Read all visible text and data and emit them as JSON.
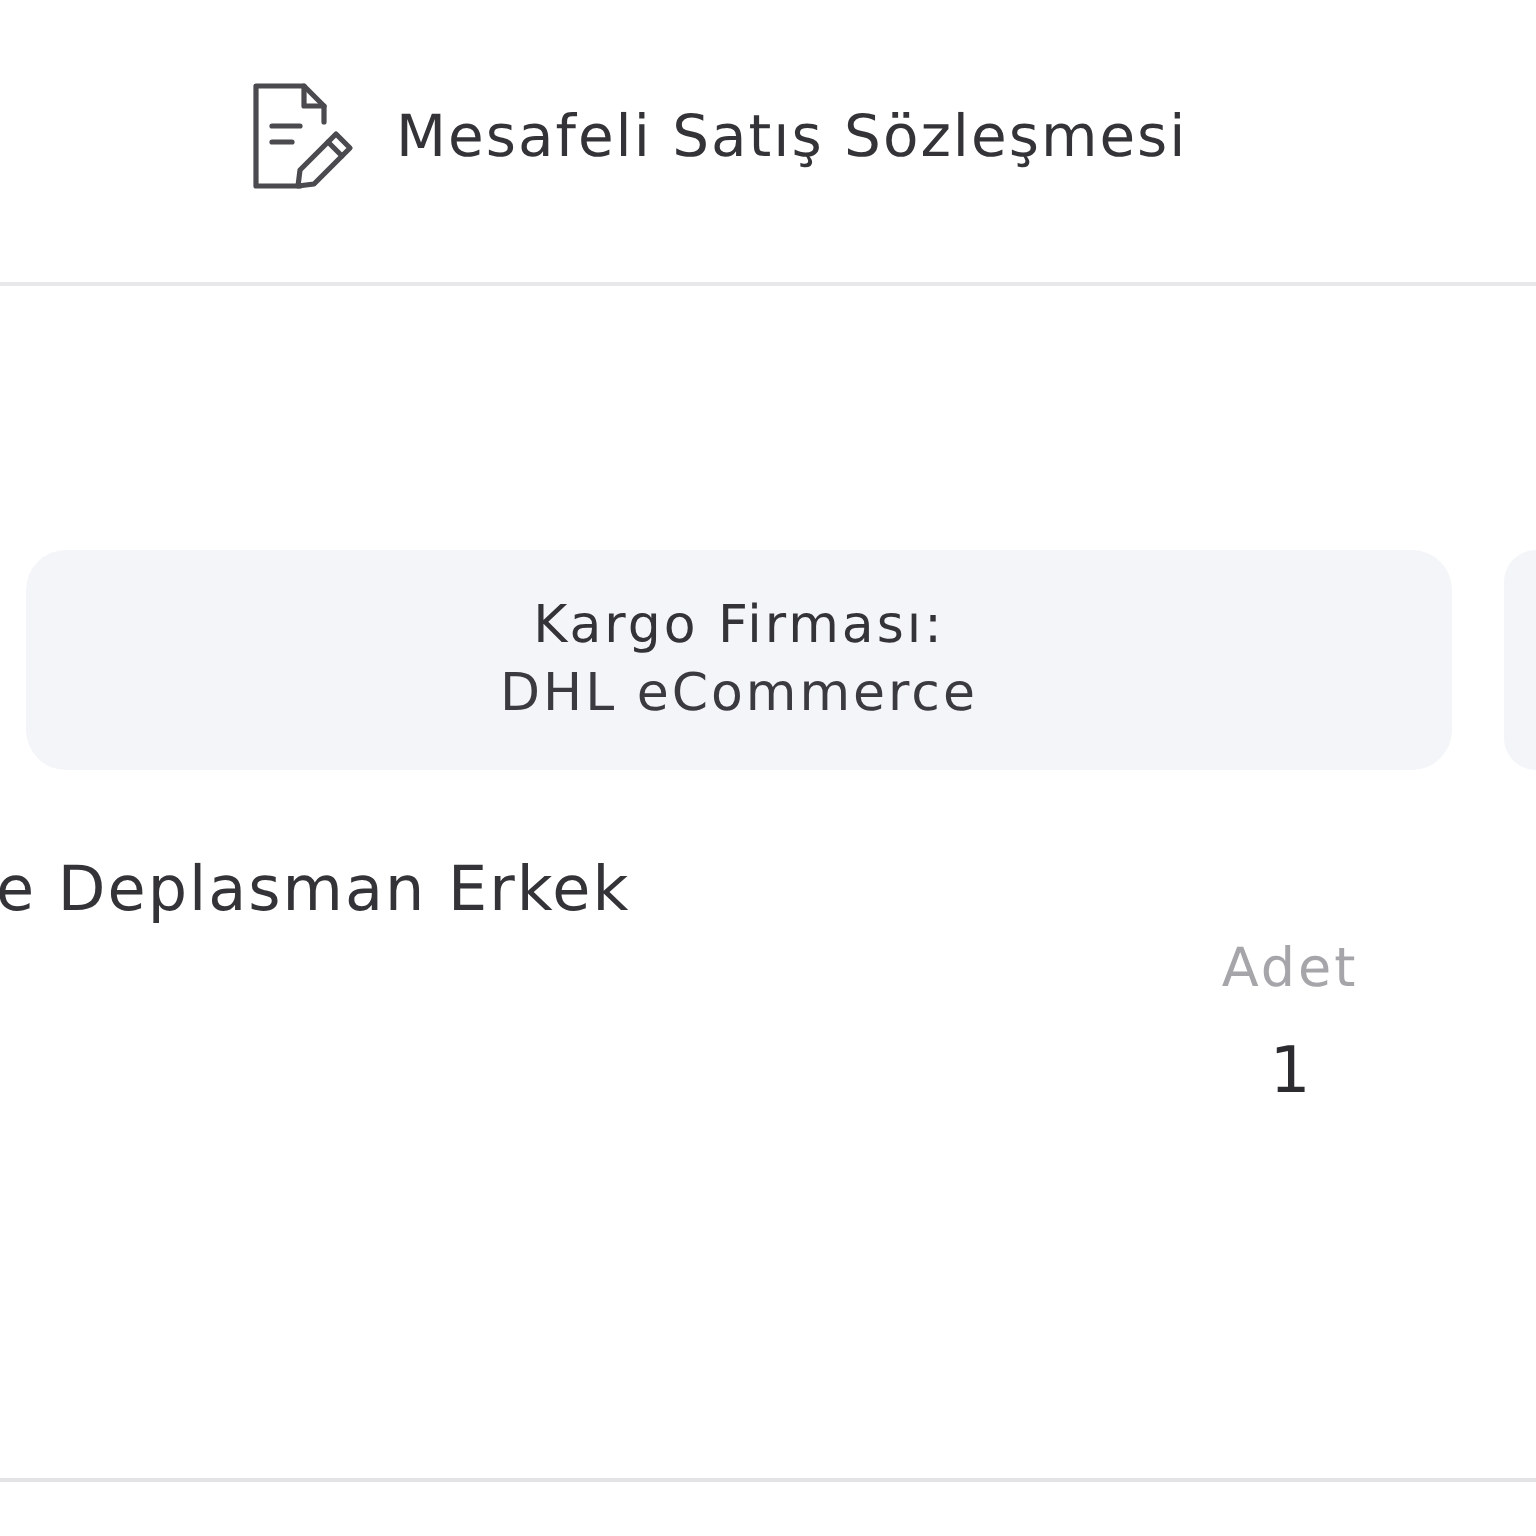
{
  "header": {
    "link": "Mesafeli Satış Sözleşmesi"
  },
  "shipping_card": {
    "label": "Kargo Firması:",
    "value": "DHL eCommerce"
  },
  "product": {
    "name": "e Deplasman Erkek",
    "quantity_label": "Adet",
    "quantity": "1"
  }
}
